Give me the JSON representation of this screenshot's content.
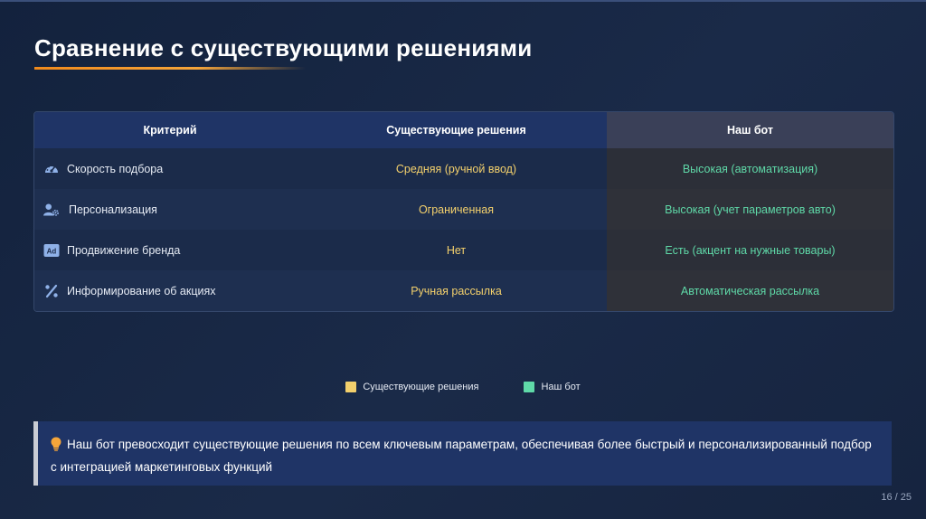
{
  "slide": {
    "title": "Сравнение с существующими решениями",
    "page_number": "16 / 25"
  },
  "table": {
    "headers": [
      "Критерий",
      "Существующие решения",
      "Наш бот"
    ],
    "rows": [
      {
        "icon": "speedometer-icon",
        "criterion": "Скорость подбора",
        "existing": "Средняя (ручной ввод)",
        "ours": "Высокая (автоматизация)"
      },
      {
        "icon": "user-gear-icon",
        "criterion": "Персонализация",
        "existing": "Ограниченная",
        "ours": "Высокая (учет параметров авто)"
      },
      {
        "icon": "ad-icon",
        "criterion": "Продвижение бренда",
        "existing": "Нет",
        "ours": "Есть (акцент на нужные товары)"
      },
      {
        "icon": "percent-icon",
        "criterion": "Информирование об акциях",
        "existing": "Ручная рассылка",
        "ours": "Автоматическая рассылка"
      }
    ]
  },
  "legend": {
    "existing_label": "Существующие решения",
    "ours_label": "Наш бот"
  },
  "note": {
    "icon": "lightbulb-icon",
    "text": "Наш бот превосходит существующие решения по всем ключевым параметрам, обеспечивая более быстрый и персонализированный подбор с интеграцией маркетинговых функций"
  },
  "colors": {
    "accent_orange": "#f08a1c",
    "existing_yellow": "#f3d06c",
    "ours_green": "#5fd9a8",
    "header_blue": "#1f3466"
  }
}
